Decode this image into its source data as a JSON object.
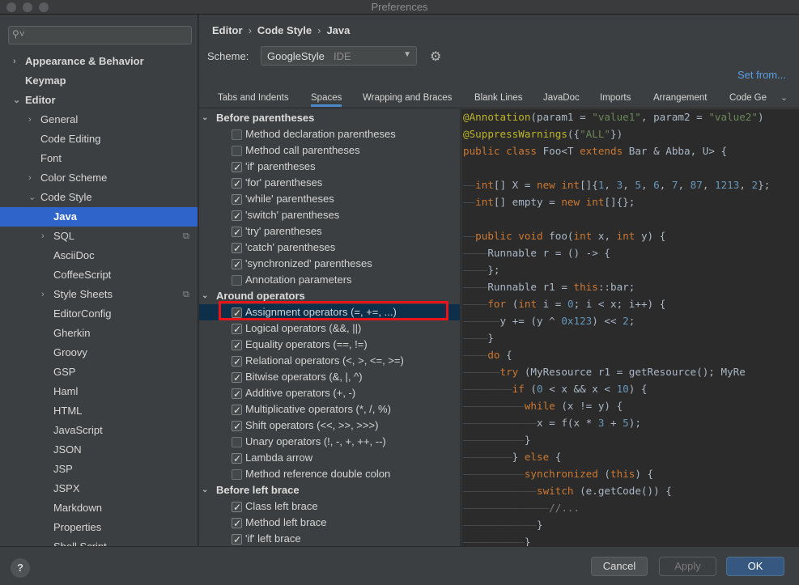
{
  "window": {
    "title": "Preferences"
  },
  "sidebar": {
    "search_placeholder": "",
    "items": [
      {
        "label": "Appearance & Behavior",
        "bold": true,
        "arrow": "›",
        "level": 0
      },
      {
        "label": "Keymap",
        "bold": true,
        "arrow": "",
        "level": 0
      },
      {
        "label": "Editor",
        "bold": true,
        "arrow": "⌄",
        "level": 0
      },
      {
        "label": "General",
        "arrow": "›",
        "level": 1
      },
      {
        "label": "Code Editing",
        "arrow": "",
        "level": 1
      },
      {
        "label": "Font",
        "arrow": "",
        "level": 1
      },
      {
        "label": "Color Scheme",
        "arrow": "›",
        "level": 1
      },
      {
        "label": "Code Style",
        "arrow": "⌄",
        "level": 1
      },
      {
        "label": "Java",
        "arrow": "",
        "level": 2,
        "selected": true
      },
      {
        "label": "SQL",
        "arrow": "›",
        "level": 2,
        "copy": true
      },
      {
        "label": "AsciiDoc",
        "arrow": "",
        "level": 2
      },
      {
        "label": "CoffeeScript",
        "arrow": "",
        "level": 2
      },
      {
        "label": "Style Sheets",
        "arrow": "›",
        "level": 2,
        "copy": true
      },
      {
        "label": "EditorConfig",
        "arrow": "",
        "level": 2
      },
      {
        "label": "Gherkin",
        "arrow": "",
        "level": 2
      },
      {
        "label": "Groovy",
        "arrow": "",
        "level": 2
      },
      {
        "label": "GSP",
        "arrow": "",
        "level": 2
      },
      {
        "label": "Haml",
        "arrow": "",
        "level": 2
      },
      {
        "label": "HTML",
        "arrow": "",
        "level": 2
      },
      {
        "label": "JavaScript",
        "arrow": "",
        "level": 2
      },
      {
        "label": "JSON",
        "arrow": "",
        "level": 2
      },
      {
        "label": "JSP",
        "arrow": "",
        "level": 2
      },
      {
        "label": "JSPX",
        "arrow": "",
        "level": 2
      },
      {
        "label": "Markdown",
        "arrow": "",
        "level": 2
      },
      {
        "label": "Properties",
        "arrow": "",
        "level": 2
      },
      {
        "label": "Shell Script",
        "arrow": "",
        "level": 2
      }
    ]
  },
  "header": {
    "breadcrumb": [
      "Editor",
      "Code Style",
      "Java"
    ],
    "scheme_label": "Scheme:",
    "scheme_value": "GoogleStyle",
    "scheme_tag": "IDE",
    "set_from": "Set from..."
  },
  "tabs": [
    {
      "label": "Tabs and Indents"
    },
    {
      "label": "Spaces",
      "active": true
    },
    {
      "label": "Wrapping and Braces"
    },
    {
      "label": "Blank Lines"
    },
    {
      "label": "JavaDoc"
    },
    {
      "label": "Imports"
    },
    {
      "label": "Arrangement"
    },
    {
      "label": "Code Ge"
    }
  ],
  "options": [
    {
      "type": "group",
      "label": "Before parentheses"
    },
    {
      "type": "option",
      "label": "Method declaration parentheses",
      "checked": false
    },
    {
      "type": "option",
      "label": "Method call parentheses",
      "checked": false
    },
    {
      "type": "option",
      "label": "'if' parentheses",
      "checked": true
    },
    {
      "type": "option",
      "label": "'for' parentheses",
      "checked": true
    },
    {
      "type": "option",
      "label": "'while' parentheses",
      "checked": true
    },
    {
      "type": "option",
      "label": "'switch' parentheses",
      "checked": true
    },
    {
      "type": "option",
      "label": "'try' parentheses",
      "checked": true
    },
    {
      "type": "option",
      "label": "'catch' parentheses",
      "checked": true
    },
    {
      "type": "option",
      "label": "'synchronized' parentheses",
      "checked": true
    },
    {
      "type": "option",
      "label": "Annotation parameters",
      "checked": false
    },
    {
      "type": "group",
      "label": "Around operators"
    },
    {
      "type": "option",
      "label": "Assignment operators (=, +=, ...)",
      "checked": true,
      "highlight": true
    },
    {
      "type": "option",
      "label": "Logical operators (&&, ||)",
      "checked": true
    },
    {
      "type": "option",
      "label": "Equality operators (==, !=)",
      "checked": true
    },
    {
      "type": "option",
      "label": "Relational operators (<, >, <=, >=)",
      "checked": true
    },
    {
      "type": "option",
      "label": "Bitwise operators (&, |, ^)",
      "checked": true
    },
    {
      "type": "option",
      "label": "Additive operators (+, -)",
      "checked": true
    },
    {
      "type": "option",
      "label": "Multiplicative operators (*, /, %)",
      "checked": true
    },
    {
      "type": "option",
      "label": "Shift operators (<<, >>, >>>)",
      "checked": true
    },
    {
      "type": "option",
      "label": "Unary operators (!, -, +, ++, --)",
      "checked": false
    },
    {
      "type": "option",
      "label": "Lambda arrow",
      "checked": true
    },
    {
      "type": "option",
      "label": "Method reference double colon",
      "checked": false
    },
    {
      "type": "group",
      "label": "Before left brace"
    },
    {
      "type": "option",
      "label": "Class left brace",
      "checked": true
    },
    {
      "type": "option",
      "label": "Method left brace",
      "checked": true
    },
    {
      "type": "option",
      "label": "'if' left brace",
      "checked": true
    }
  ],
  "code": [
    [
      [
        "a",
        "@Annotation"
      ],
      [
        "p",
        "(param1 = "
      ],
      [
        "s",
        "\"value1\""
      ],
      [
        "p",
        ", param2 = "
      ],
      [
        "s",
        "\"value2\""
      ],
      [
        "p",
        ")"
      ]
    ],
    [
      [
        "a",
        "@SuppressWarnings"
      ],
      [
        "p",
        "({"
      ],
      [
        "s",
        "\"ALL\""
      ],
      [
        "p",
        "})"
      ]
    ],
    [
      [
        "k",
        "public class "
      ],
      [
        "p",
        "Foo<T "
      ],
      [
        "k",
        "extends "
      ],
      [
        "p",
        "Bar & Abba, U> {"
      ]
    ],
    [],
    [
      [
        "g",
        "——"
      ],
      [
        "k",
        "int"
      ],
      [
        "p",
        "[] X = "
      ],
      [
        "k",
        "new int"
      ],
      [
        "p",
        "[]{"
      ],
      [
        "n",
        "1"
      ],
      [
        "p",
        ", "
      ],
      [
        "n",
        "3"
      ],
      [
        "p",
        ", "
      ],
      [
        "n",
        "5"
      ],
      [
        "p",
        ", "
      ],
      [
        "n",
        "6"
      ],
      [
        "p",
        ", "
      ],
      [
        "n",
        "7"
      ],
      [
        "p",
        ", "
      ],
      [
        "n",
        "87"
      ],
      [
        "p",
        ", "
      ],
      [
        "n",
        "1213"
      ],
      [
        "p",
        ", "
      ],
      [
        "n",
        "2"
      ],
      [
        "p",
        "};"
      ]
    ],
    [
      [
        "g",
        "——"
      ],
      [
        "k",
        "int"
      ],
      [
        "p",
        "[] empty = "
      ],
      [
        "k",
        "new int"
      ],
      [
        "p",
        "[]{};"
      ]
    ],
    [],
    [
      [
        "g",
        "——"
      ],
      [
        "k",
        "public void "
      ],
      [
        "p",
        "foo("
      ],
      [
        "k",
        "int "
      ],
      [
        "p",
        "x, "
      ],
      [
        "k",
        "int "
      ],
      [
        "p",
        "y) {"
      ]
    ],
    [
      [
        "g",
        "————"
      ],
      [
        "p",
        "Runnable r = () -> {"
      ]
    ],
    [
      [
        "g",
        "————"
      ],
      [
        "p",
        "};"
      ]
    ],
    [
      [
        "g",
        "————"
      ],
      [
        "p",
        "Runnable r1 = "
      ],
      [
        "k",
        "this"
      ],
      [
        "p",
        "::bar;"
      ]
    ],
    [
      [
        "g",
        "————"
      ],
      [
        "k",
        "for "
      ],
      [
        "p",
        "("
      ],
      [
        "k",
        "int "
      ],
      [
        "p",
        "i = "
      ],
      [
        "n",
        "0"
      ],
      [
        "p",
        "; i < x; i++) {"
      ]
    ],
    [
      [
        "g",
        "——————"
      ],
      [
        "p",
        "y += (y ^ "
      ],
      [
        "n",
        "0x123"
      ],
      [
        "p",
        ") << "
      ],
      [
        "n",
        "2"
      ],
      [
        "p",
        ";"
      ]
    ],
    [
      [
        "g",
        "————"
      ],
      [
        "p",
        "}"
      ]
    ],
    [
      [
        "g",
        "————"
      ],
      [
        "k",
        "do "
      ],
      [
        "p",
        "{"
      ]
    ],
    [
      [
        "g",
        "——————"
      ],
      [
        "k",
        "try "
      ],
      [
        "p",
        "(MyResource r1 = getResource(); MyRe"
      ]
    ],
    [
      [
        "g",
        "————————"
      ],
      [
        "k",
        "if "
      ],
      [
        "p",
        "("
      ],
      [
        "n",
        "0 "
      ],
      [
        "p",
        "< x && x < "
      ],
      [
        "n",
        "10"
      ],
      [
        "p",
        ") {"
      ]
    ],
    [
      [
        "g",
        "——————————"
      ],
      [
        "k",
        "while "
      ],
      [
        "p",
        "(x != y) {"
      ]
    ],
    [
      [
        "g",
        "————————————"
      ],
      [
        "p",
        "x = f(x * "
      ],
      [
        "n",
        "3 "
      ],
      [
        "p",
        "+ "
      ],
      [
        "n",
        "5"
      ],
      [
        "p",
        ");"
      ]
    ],
    [
      [
        "g",
        "——————————"
      ],
      [
        "p",
        "}"
      ]
    ],
    [
      [
        "g",
        "————————"
      ],
      [
        "p",
        "} "
      ],
      [
        "k",
        "else "
      ],
      [
        "p",
        "{"
      ]
    ],
    [
      [
        "g",
        "——————————"
      ],
      [
        "k",
        "synchronized "
      ],
      [
        "p",
        "("
      ],
      [
        "k",
        "this"
      ],
      [
        "p",
        ") {"
      ]
    ],
    [
      [
        "g",
        "————————————"
      ],
      [
        "k",
        "switch "
      ],
      [
        "p",
        "(e.getCode()) {"
      ]
    ],
    [
      [
        "g",
        "——————————————"
      ],
      [
        "c",
        "//..."
      ]
    ],
    [
      [
        "g",
        "————————————"
      ],
      [
        "p",
        "}"
      ]
    ],
    [
      [
        "g",
        "——————————"
      ],
      [
        "p",
        "}"
      ]
    ]
  ],
  "footer": {
    "help": "?",
    "cancel": "Cancel",
    "apply": "Apply",
    "ok": "OK"
  }
}
